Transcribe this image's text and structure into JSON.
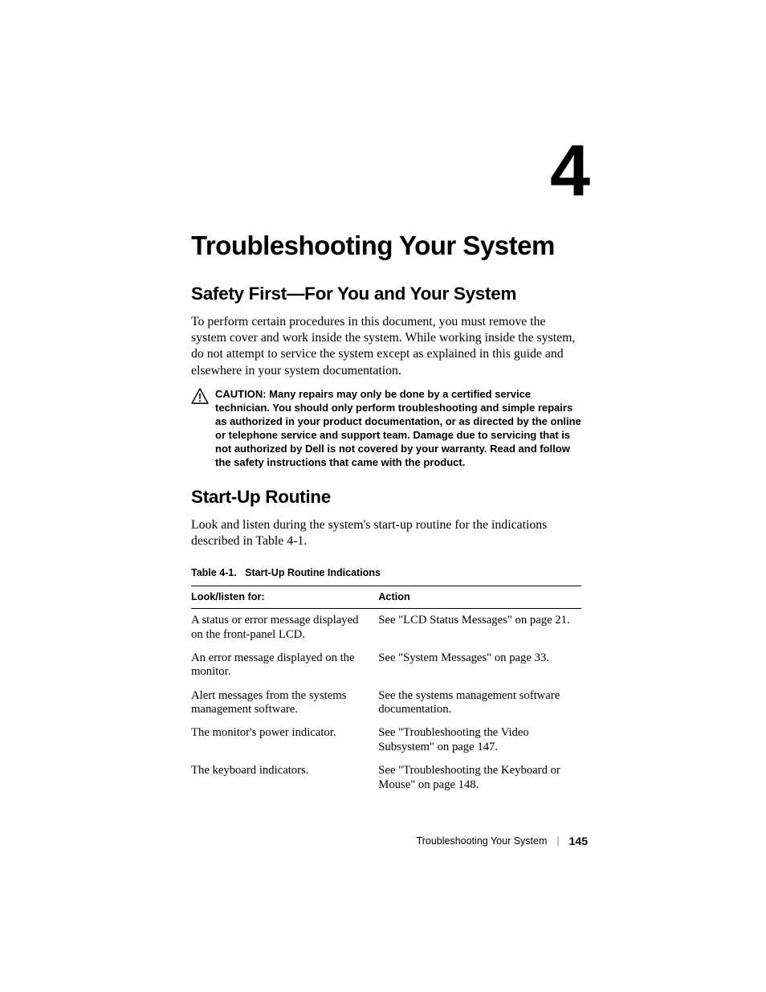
{
  "chapter": {
    "number": "4",
    "title": "Troubleshooting Your System"
  },
  "sections": {
    "safety": {
      "heading": "Safety First—For You and Your System",
      "body": "To perform certain procedures in this document, you must remove the system cover and work inside the system. While working inside the system, do not attempt to service the system except as explained in this guide and elsewhere in your system documentation."
    },
    "caution": {
      "label": "CAUTION:",
      "body": "Many repairs may only be done by a certified service technician. You should only perform troubleshooting and simple repairs as authorized in your product documentation, or as directed by the online or telephone service and support team. Damage due to servicing that is not authorized by Dell is not covered by your warranty. Read and follow the safety instructions that came with the product."
    },
    "startup": {
      "heading": "Start-Up Routine",
      "body": "Look and listen during the system's start-up routine for the indications described in Table 4-1."
    }
  },
  "table": {
    "caption_prefix": "Table 4-1.",
    "caption_title": "Start-Up Routine Indications",
    "headers": {
      "look": "Look/listen for:",
      "action": "Action"
    },
    "rows": [
      {
        "look": "A status or error message displayed on the front-panel LCD.",
        "action": "See \"LCD Status Messages\" on page 21."
      },
      {
        "look": "An error message displayed on the monitor.",
        "action": "See \"System Messages\" on page 33."
      },
      {
        "look": "Alert messages from the systems management software.",
        "action": "See the systems management software documentation."
      },
      {
        "look": "The monitor's power indicator.",
        "action": "See \"Troubleshooting the Video Subsystem\" on page 147."
      },
      {
        "look": "The keyboard indicators.",
        "action": "See \"Troubleshooting the Keyboard or Mouse\" on page 148."
      }
    ]
  },
  "footer": {
    "section": "Troubleshooting Your System",
    "page": "145"
  }
}
